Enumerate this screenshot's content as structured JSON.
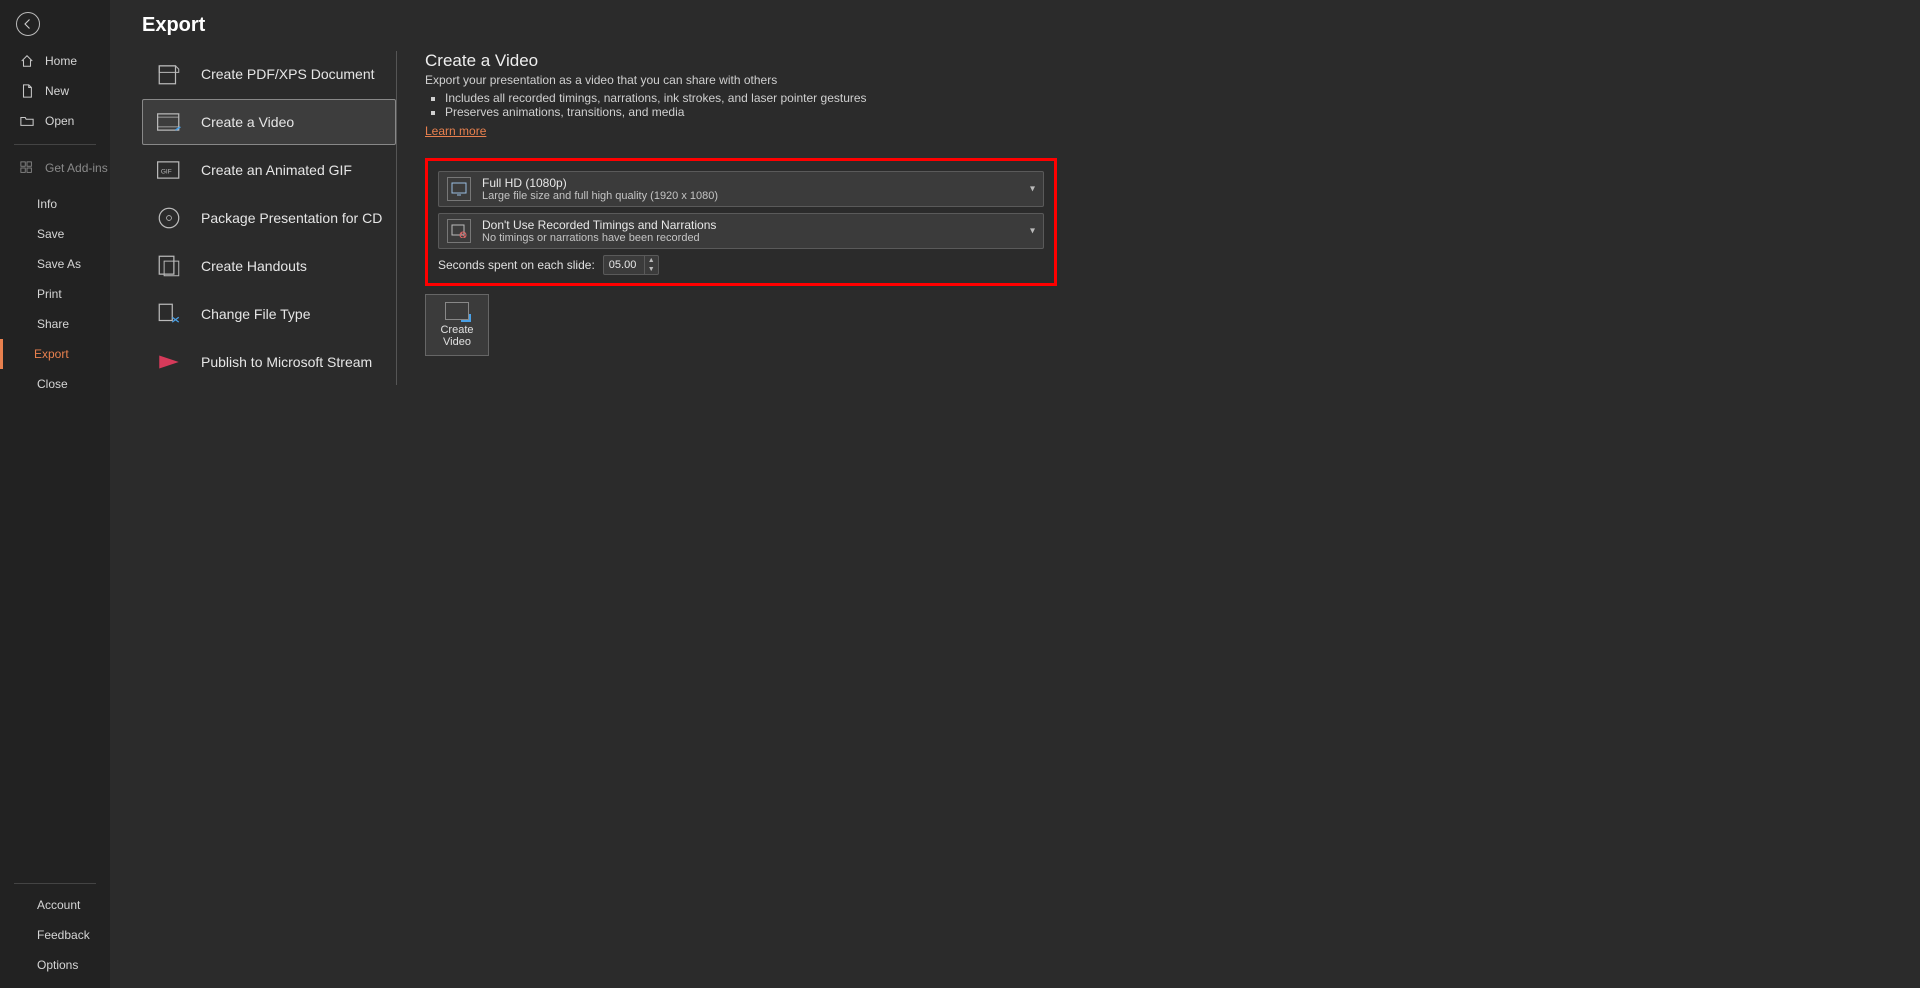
{
  "nav": {
    "home": "Home",
    "new": "New",
    "open": "Open",
    "get_addins": "Get Add-ins",
    "info": "Info",
    "save": "Save",
    "save_as": "Save As",
    "print": "Print",
    "share": "Share",
    "export": "Export",
    "close": "Close",
    "account": "Account",
    "feedback": "Feedback",
    "options": "Options"
  },
  "page_title": "Export",
  "options": {
    "pdf": "Create PDF/XPS Document",
    "video": "Create a Video",
    "gif": "Create an Animated GIF",
    "package": "Package Presentation for CD",
    "handouts": "Create Handouts",
    "filetype": "Change File Type",
    "stream": "Publish to Microsoft Stream"
  },
  "detail": {
    "title": "Create a Video",
    "subtitle": "Export your presentation as a video that you can share with others",
    "bullet1": "Includes all recorded timings, narrations, ink strokes, and laser pointer gestures",
    "bullet2": "Preserves animations, transitions, and media",
    "learn_more": "Learn more",
    "quality_title": "Full HD (1080p)",
    "quality_sub": "Large file size and full high quality (1920 x 1080)",
    "timings_title": "Don't Use Recorded Timings and Narrations",
    "timings_sub": "No timings or narrations have been recorded",
    "seconds_label": "Seconds spent on each slide:",
    "seconds_value": "05.00",
    "create_line1": "Create",
    "create_line2": "Video"
  }
}
